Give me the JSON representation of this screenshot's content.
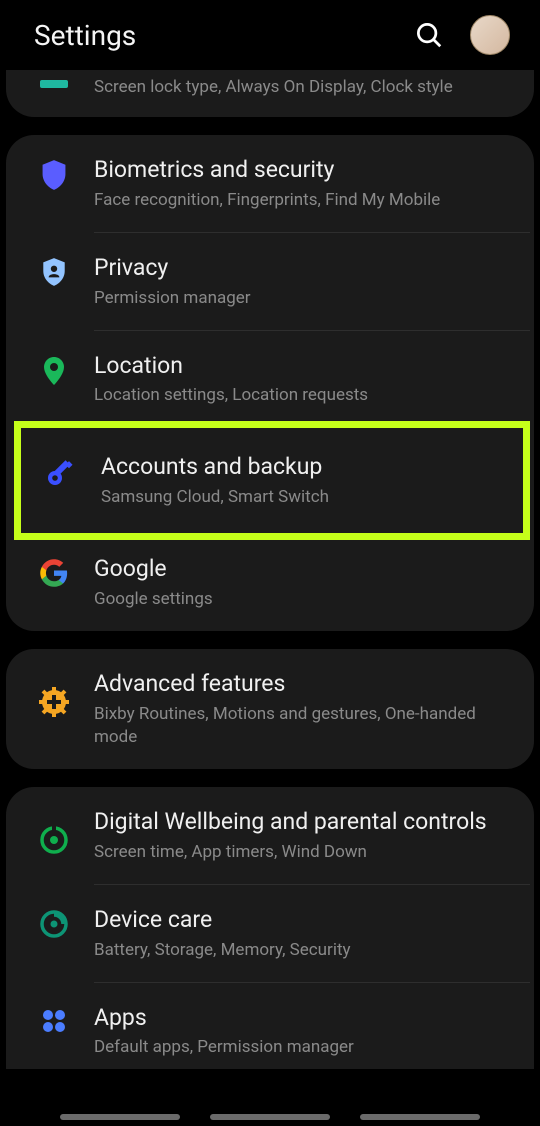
{
  "header": {
    "title": "Settings"
  },
  "groups": [
    {
      "items": [
        {
          "title": "",
          "sub": "Screen lock type, Always On Display, Clock style",
          "icon": "lock-screen",
          "partial_top": true
        }
      ]
    },
    {
      "items": [
        {
          "title": "Biometrics and security",
          "sub": "Face recognition, Fingerprints, Find My Mobile",
          "icon": "shield"
        },
        {
          "title": "Privacy",
          "sub": "Permission manager",
          "icon": "shield-person"
        },
        {
          "title": "Location",
          "sub": "Location settings, Location requests",
          "icon": "pin"
        },
        {
          "title": "Accounts and backup",
          "sub": "Samsung Cloud, Smart Switch",
          "icon": "key",
          "highlighted": true
        },
        {
          "title": "Google",
          "sub": "Google settings",
          "icon": "google"
        }
      ]
    },
    {
      "items": [
        {
          "title": "Advanced features",
          "sub": "Bixby Routines, Motions and gestures, One-handed mode",
          "icon": "plus-gear"
        }
      ]
    },
    {
      "items": [
        {
          "title": "Digital Wellbeing and parental controls",
          "sub": "Screen time, App timers, Wind Down",
          "icon": "wellbeing"
        },
        {
          "title": "Device care",
          "sub": "Battery, Storage, Memory, Security",
          "icon": "device-care"
        },
        {
          "title": "Apps",
          "sub": "Default apps, Permission manager",
          "icon": "apps"
        }
      ]
    }
  ]
}
